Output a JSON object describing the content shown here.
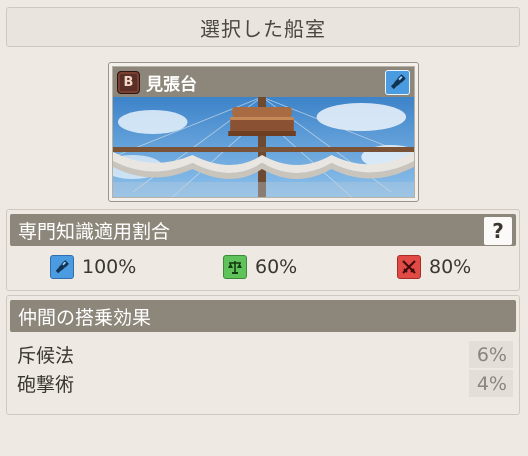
{
  "page": {
    "title": "選択した船室"
  },
  "cabin": {
    "rank": "B",
    "name": "見張台",
    "rank_icon": "rank-b-icon",
    "skill_icon": "spyglass-icon"
  },
  "expertise": {
    "title": "専門知識適用割合",
    "help_label": "?",
    "rates": [
      {
        "icon": "spyglass-icon",
        "color": "#4b9be0",
        "value": "100%"
      },
      {
        "icon": "scales-icon",
        "color": "#5fc25a",
        "value": "60%"
      },
      {
        "icon": "crossed-swords-icon",
        "color": "#e14a45",
        "value": "80%"
      }
    ]
  },
  "crew_effects": {
    "title": "仲間の搭乗効果",
    "items": [
      {
        "name": "斥候法",
        "value": "6%"
      },
      {
        "name": "砲撃術",
        "value": "4%"
      }
    ]
  }
}
